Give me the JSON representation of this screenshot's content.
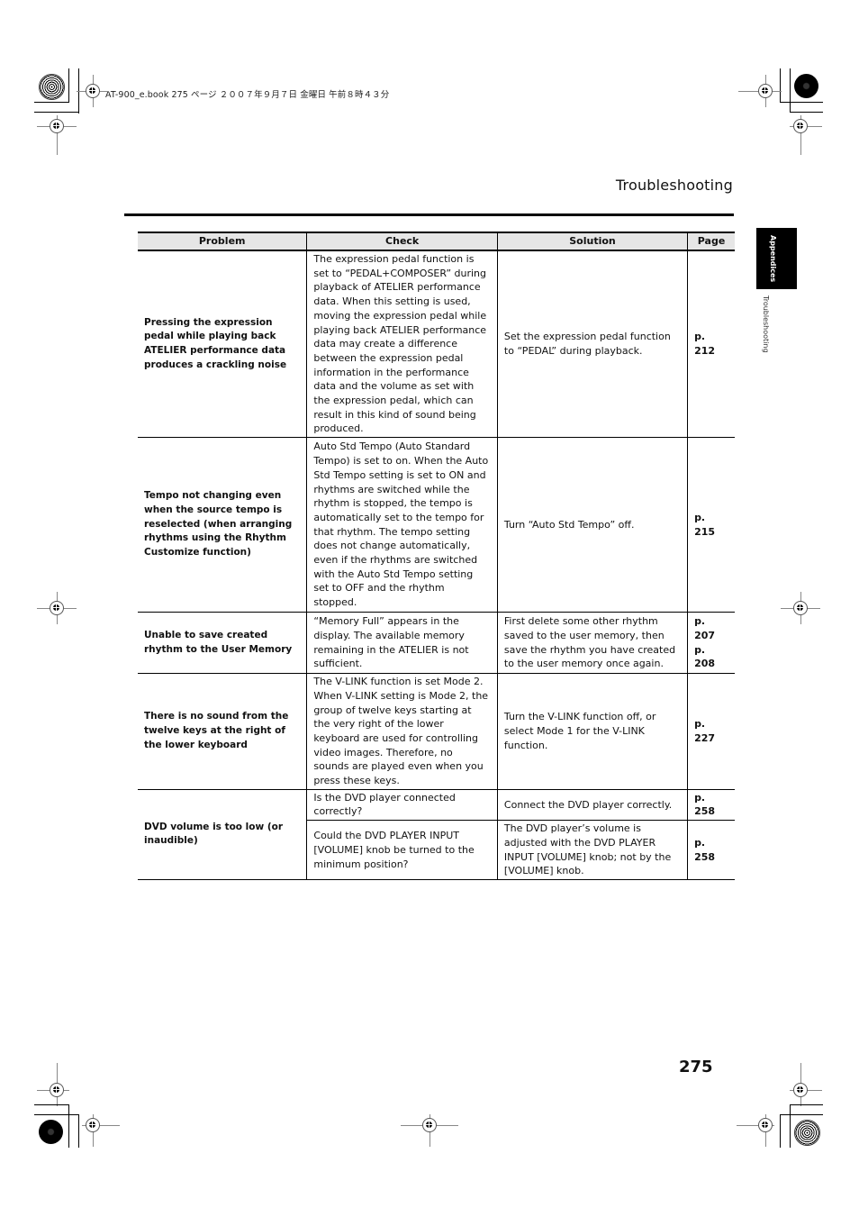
{
  "print_header": "AT-900_e.book  275 ページ  ２００７年９月７日  金曜日  午前８時４３分",
  "section_title": "Troubleshooting",
  "side_tab": {
    "label": "Appendices",
    "sub_label": "Troubleshooting"
  },
  "table": {
    "headers": [
      "Problem",
      "Check",
      "Solution",
      "Page"
    ],
    "rows": [
      {
        "problem": "Pressing the expression pedal while playing back ATELIER performance data produces a crackling noise",
        "checks": [
          {
            "check": "The expression pedal function is set to “PEDAL+COMPOSER” during playback of ATELIER performance data. When this setting is used, moving the expression pedal while playing back ATELIER performance data may create a difference between the expression pedal information in the performance data and the volume as set with the expression pedal, which can result in this kind of sound being produced.",
            "solution": "Set the expression pedal function to “PEDAL” during playback.",
            "page": "p. 212"
          }
        ]
      },
      {
        "problem": "Tempo not changing even when the source tempo is reselected (when arranging rhythms using the Rhythm Customize function)",
        "checks": [
          {
            "check": "Auto Std Tempo (Auto Standard Tempo) is set to on. When the Auto Std Tempo setting is set to ON and rhythms are switched while the rhythm is stopped, the tempo is automatically set to the tempo for that rhythm. The tempo setting does not change automatically, even if the rhythms are switched with the Auto Std Tempo setting set to OFF and the rhythm stopped.",
            "solution": "Turn “Auto Std Tempo” off.",
            "page": "p. 215"
          }
        ]
      },
      {
        "problem": "Unable to save created rhythm to the User Memory",
        "checks": [
          {
            "check": "“Memory Full” appears in the display. The available memory remaining in the ATELIER is not sufficient.",
            "solution": "First delete some other rhythm saved to the user memory, then save the rhythm you have created to the user memory once again.",
            "page": "p. 207",
            "page2": "p. 208"
          }
        ]
      },
      {
        "problem": "There is no sound from the twelve keys at the right of the lower keyboard",
        "checks": [
          {
            "check": "The V-LINK function is set Mode 2. When V-LINK setting is Mode 2, the group of twelve keys starting at the very right of the lower keyboard are used for controlling video images. Therefore, no sounds are played even when you press these keys.",
            "solution": "Turn the V-LINK function off, or select Mode 1 for the V-LINK function.",
            "page": "p. 227"
          }
        ]
      },
      {
        "problem": "DVD volume is too low (or inaudible)",
        "checks": [
          {
            "check": "Is the DVD player connected correctly?",
            "solution": "Connect the DVD player correctly.",
            "page": "p. 258"
          },
          {
            "check": "Could the DVD PLAYER INPUT [VOLUME] knob be turned to the minimum position?",
            "solution": "The DVD player’s volume is adjusted with the DVD PLAYER INPUT [VOLUME] knob; not by the [VOLUME] knob.",
            "page": "p. 258"
          }
        ]
      }
    ]
  },
  "page_number": "275"
}
